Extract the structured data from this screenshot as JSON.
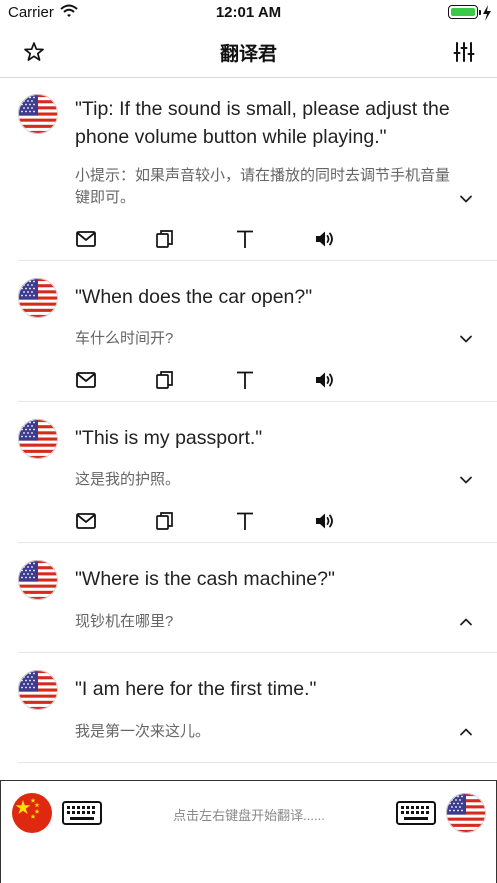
{
  "status_bar": {
    "carrier": "Carrier",
    "time": "12:01 AM",
    "battery_percent": 100
  },
  "nav": {
    "title": "翻译君",
    "left_icon": "star-outline-icon",
    "right_icon": "sliders-icon"
  },
  "items": [
    {
      "source": "\"Tip: If the sound is small, please adjust the phone volume button while playing.\"",
      "target": "小提示：如果声音较小，请在播放的同时去调节手机音量键即可。",
      "expanded": false,
      "chevron": "chevron-down-icon",
      "has_actions": true
    },
    {
      "source": "\"When does the car open?\"",
      "target": "车什么时间开?",
      "expanded": false,
      "chevron": "chevron-down-icon",
      "has_actions": true
    },
    {
      "source": "\"This is my passport.\"",
      "target": "这是我的护照。",
      "expanded": false,
      "chevron": "chevron-down-icon",
      "has_actions": true
    },
    {
      "source": "\"Where is the cash machine?\"",
      "target": "现钞机在哪里?",
      "expanded": true,
      "chevron": "chevron-up-icon",
      "has_actions": false
    },
    {
      "source": "\"I am here for the first time.\"",
      "target": "我是第一次来这儿。",
      "expanded": true,
      "chevron": "chevron-up-icon",
      "has_actions": false
    }
  ],
  "actions": [
    "mail-icon",
    "copy-icon",
    "text-icon",
    "speaker-icon"
  ],
  "bottom_bar": {
    "hint": "点击左右键盘开始翻译......",
    "left_language_flag": "china-flag-icon",
    "right_language_flag": "us-flag-icon",
    "keyboard_icon": "keyboard-icon"
  },
  "colors": {
    "flag_red": "#d52b1e",
    "flag_blue": "#3c3b8f",
    "cn_red": "#de2910",
    "cn_yellow": "#ffde00",
    "battery_green": "#3dc948"
  }
}
